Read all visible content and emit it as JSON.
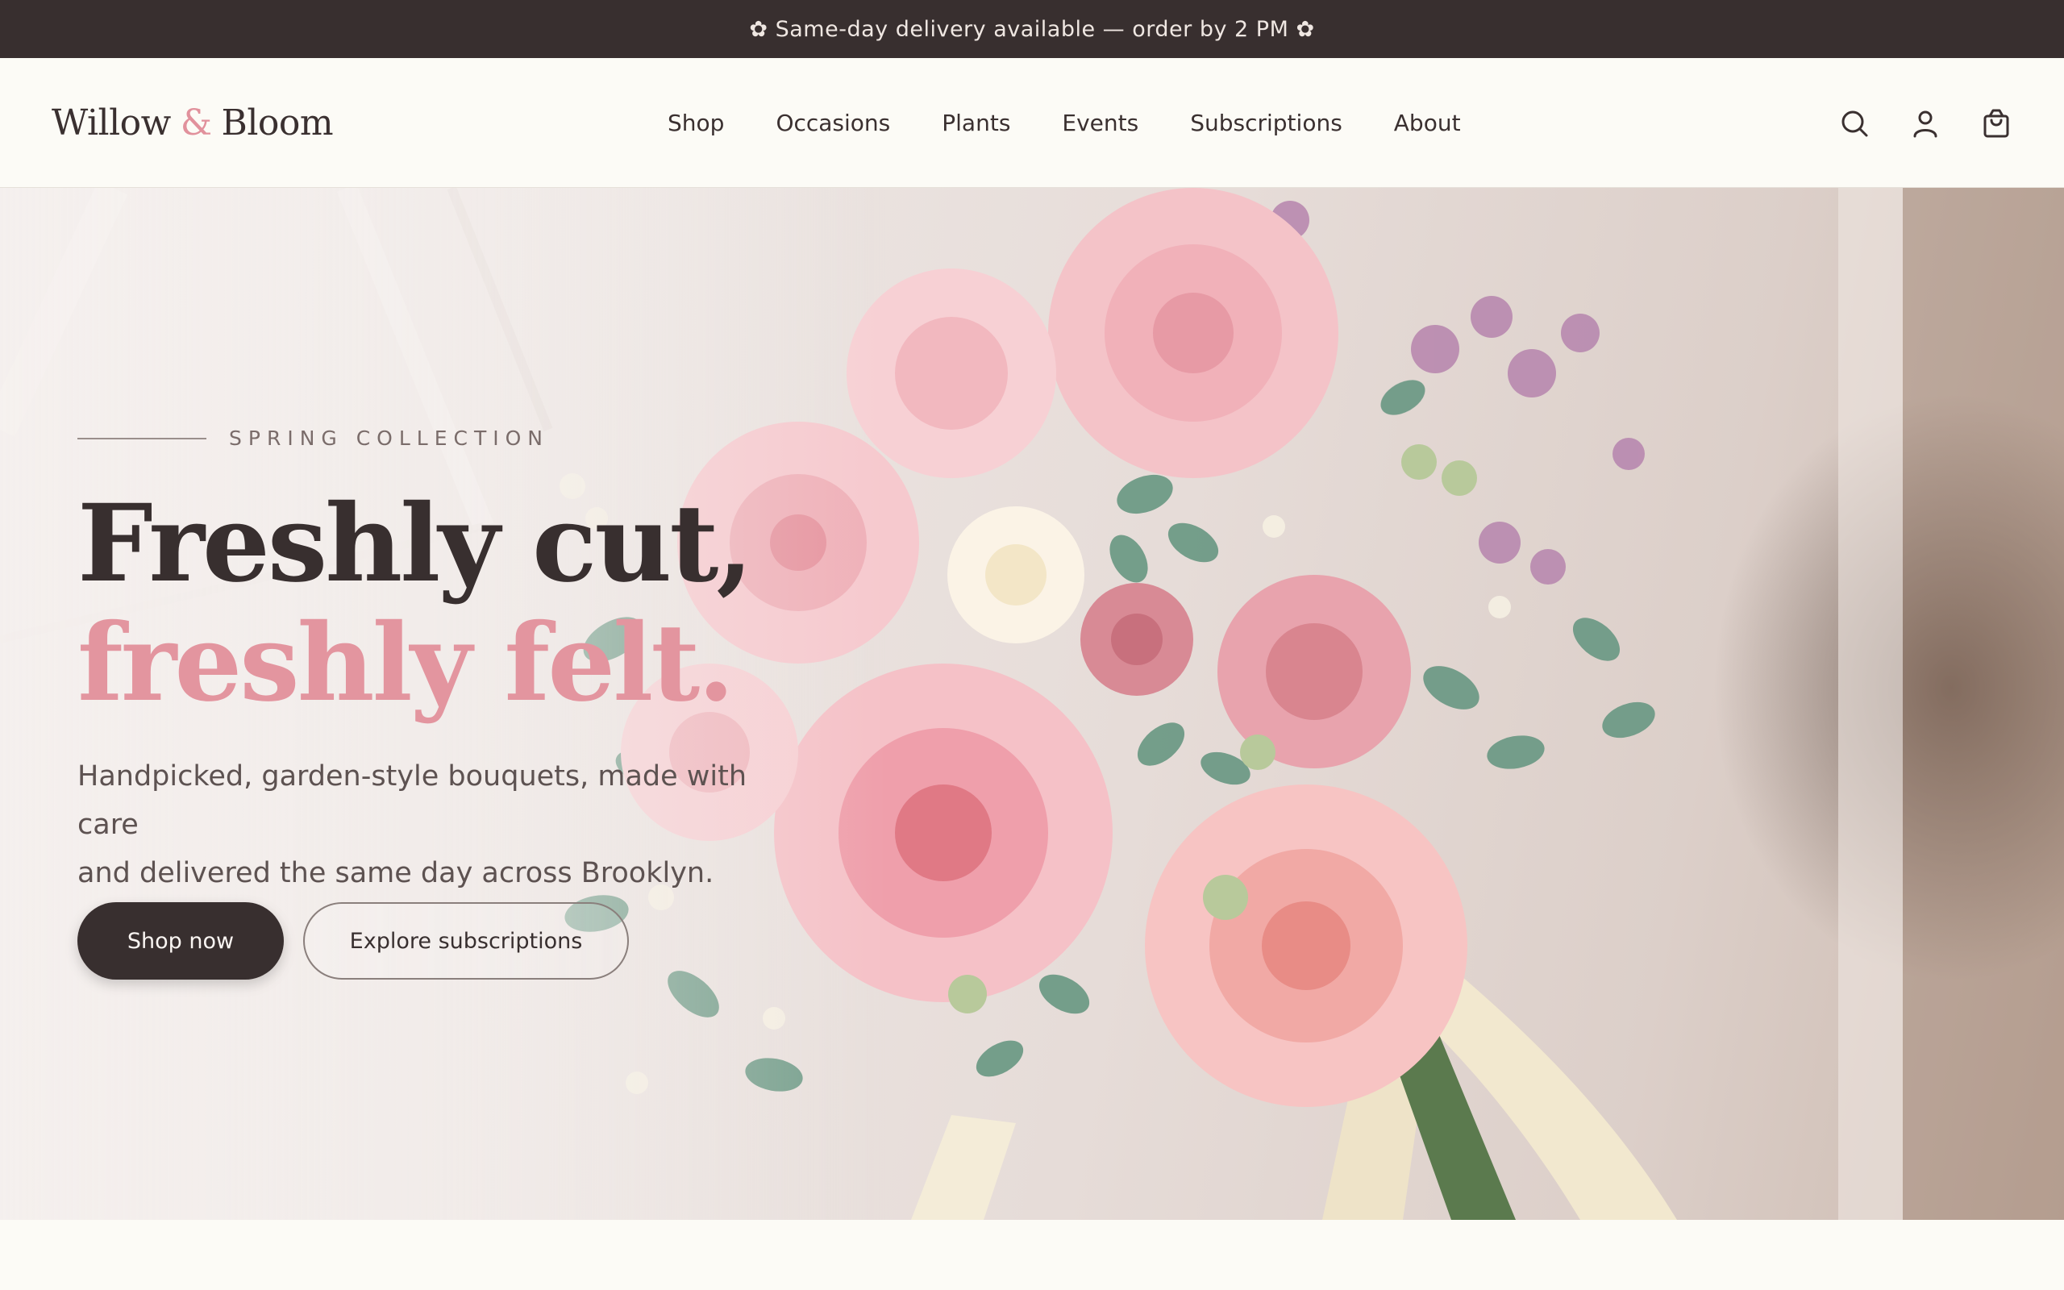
{
  "announcement": {
    "text": "✿ Same-day delivery available — order by 2 PM ✿"
  },
  "brand": {
    "name_part1": "Willow",
    "amp": "&",
    "name_part2": "Bloom"
  },
  "nav": {
    "items": [
      {
        "label": "Shop"
      },
      {
        "label": "Occasions"
      },
      {
        "label": "Plants"
      },
      {
        "label": "Events"
      },
      {
        "label": "Subscriptions"
      },
      {
        "label": "About"
      }
    ]
  },
  "header_icons": [
    "search-icon",
    "account-icon",
    "shopping-bag-icon"
  ],
  "hero": {
    "eyebrow": "SPRING COLLECTION",
    "title_line1": "Freshly cut,",
    "title_line2": "freshly felt.",
    "subtitle_line1": "Handpicked, garden-style bouquets, made with care",
    "subtitle_line2": "and delivered the same day across Brooklyn.",
    "primary_cta": "Shop now",
    "secondary_cta": "Explore subscriptions",
    "image_alt": "rose-bouquet-photo"
  },
  "colors": {
    "announcement_bg": "#382f2f",
    "accent_pink": "#e3959f",
    "text_dark": "#382f2f",
    "page_bg": "#fcfbf6"
  }
}
